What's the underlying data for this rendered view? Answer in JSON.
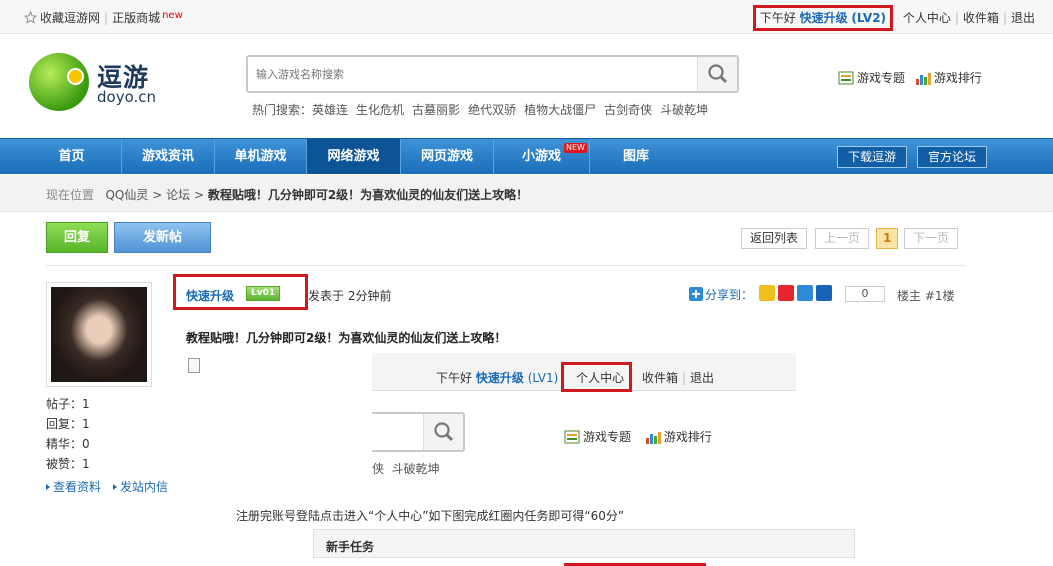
{
  "topbar": {
    "favorite": "收藏逗游网",
    "mall": "正版商城",
    "mall_badge": "new",
    "greeting": "下午好",
    "username": "快速升级",
    "level": "(LV2)",
    "links": [
      "个人中心",
      "收件箱",
      "退出"
    ]
  },
  "logo": {
    "cn": "逗游",
    "en": "doyo.cn"
  },
  "search": {
    "placeholder": "输入游戏名称搜索",
    "hot_label": "热门搜索：",
    "hot_items": [
      "英雄连",
      "生化危机",
      "古墓丽影",
      "绝代双骄",
      "植物大战僵尸",
      "古剑奇侠",
      "斗破乾坤"
    ]
  },
  "header_links": [
    "游戏专题",
    "游戏排行"
  ],
  "nav": {
    "items": [
      "首页",
      "游戏资讯",
      "单机游戏",
      "网络游戏",
      "网页游戏",
      "小游戏",
      "图库"
    ],
    "active": "网络游戏",
    "new_badge": "NEW",
    "right_buttons": [
      "下载逗游",
      "官方论坛"
    ]
  },
  "breadcrumb": {
    "label": "现在位置",
    "items": [
      "QQ仙灵",
      "论坛"
    ],
    "sep": ">",
    "current": "教程贴哦！几分钟即可2级！为喜欢仙灵的仙友们送上攻略！"
  },
  "actions": {
    "reply": "回复",
    "new_post": "发新帖",
    "back_list": "返回列表",
    "prev": "上一页",
    "page": "1",
    "next": "下一页"
  },
  "post": {
    "author": "快速升级",
    "level": "Lv01",
    "posted": "发表于 2分钟前",
    "share_label": "分享到：",
    "share_count": "0",
    "floor": "楼主 #1楼",
    "title": "教程贴哦！几分钟即可2级！为喜欢仙灵的仙友们送上攻略！",
    "stats": [
      {
        "label": "帖子：",
        "value": "1"
      },
      {
        "label": "回复：",
        "value": "1"
      },
      {
        "label": "精华：",
        "value": "0"
      },
      {
        "label": "被赞：",
        "value": "1"
      }
    ],
    "profile_links": [
      "查看资料",
      "发站内信"
    ]
  },
  "embedded": {
    "greeting": "下午好",
    "username": "快速升级",
    "level": "(LV1)",
    "links": [
      "个人中心",
      "收件箱",
      "退出"
    ],
    "hot_tail": "斗破乾坤",
    "hot_prefix": "侠",
    "header_links": [
      "游戏专题",
      "游戏排行"
    ]
  },
  "instruction": "注册完账号登陆点击进入“个人中心”如下图完成红圈内任务即可得“60分”",
  "task_title": "新手任务",
  "colors": {
    "nav": "#1a6db8",
    "highlight": "#d0191f",
    "link": "#1a69b4"
  }
}
